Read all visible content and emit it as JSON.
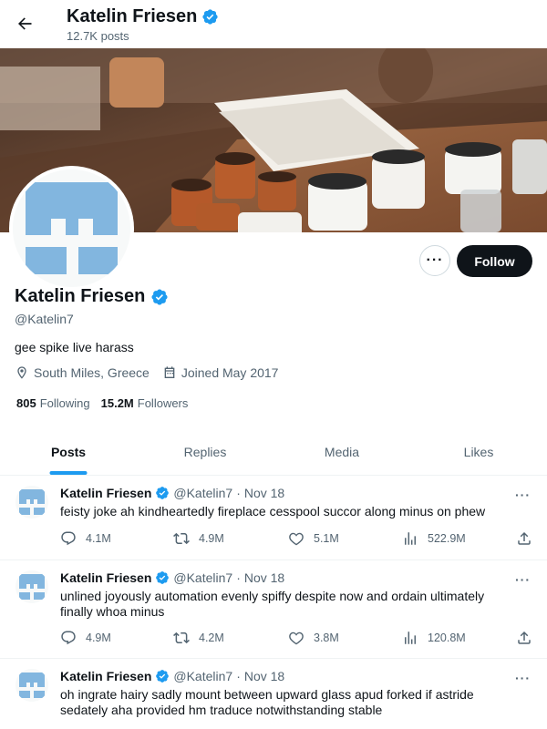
{
  "header": {
    "name": "Katelin Friesen",
    "posts_count": "12.7K posts"
  },
  "profile": {
    "name": "Katelin Friesen",
    "handle": "@Katelin7",
    "bio": "gee spike live harass",
    "location": "South Miles, Greece",
    "joined": "Joined May 2017",
    "following_count": "805",
    "following_label": "Following",
    "followers_count": "15.2M",
    "followers_label": "Followers",
    "follow_button": "Follow",
    "more_button": "···"
  },
  "tabs": [
    {
      "label": "Posts",
      "active": true
    },
    {
      "label": "Replies",
      "active": false
    },
    {
      "label": "Media",
      "active": false
    },
    {
      "label": "Likes",
      "active": false
    }
  ],
  "tweets": [
    {
      "name": "Katelin Friesen",
      "handle": "@Katelin7",
      "separator": "·",
      "date": "Nov 18",
      "text": "feisty joke ah kindheartedly fireplace cesspool succor along minus on phew",
      "replies": "4.1M",
      "retweets": "4.9M",
      "likes": "5.1M",
      "views": "522.9M"
    },
    {
      "name": "Katelin Friesen",
      "handle": "@Katelin7",
      "separator": "·",
      "date": "Nov 18",
      "text": "unlined joyously automation evenly spiffy despite now and ordain ultimately finally whoa minus",
      "replies": "4.9M",
      "retweets": "4.2M",
      "likes": "3.8M",
      "views": "120.8M"
    },
    {
      "name": "Katelin Friesen",
      "handle": "@Katelin7",
      "separator": "·",
      "date": "Nov 18",
      "text": "oh ingrate hairy sadly mount between upward glass apud forked if astride sedately aha provided hm traduce notwithstanding stable",
      "replies": "",
      "retweets": "",
      "likes": "",
      "views": ""
    }
  ],
  "colors": {
    "accent": "#1d9bf0",
    "verified": "#1d9bf0",
    "avatar_blue": "#82b6df",
    "text_primary": "#0f1419",
    "text_secondary": "#536471"
  },
  "icons": {
    "back": "arrow-left-icon",
    "verified": "verified-badge-icon",
    "location": "location-pin-icon",
    "calendar": "calendar-icon",
    "reply": "reply-icon",
    "retweet": "retweet-icon",
    "like": "heart-icon",
    "views": "views-chart-icon",
    "share": "share-icon"
  }
}
